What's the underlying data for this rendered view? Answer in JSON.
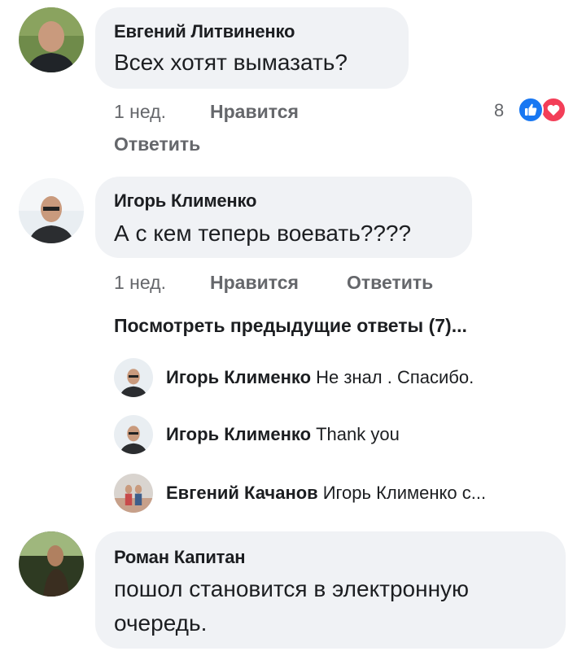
{
  "comments": [
    {
      "author": "Евгений Литвиненко",
      "text": "Всех хотят вымазать?",
      "time": "1 нед.",
      "like_label": "Нравится",
      "reply_label": "Ответить",
      "reactions": {
        "count": "8",
        "icons": [
          "like-icon",
          "love-icon"
        ],
        "colors": {
          "like": "#1877f2",
          "love": "#f33e58"
        }
      }
    },
    {
      "author": "Игорь Клименко",
      "text": "А с кем теперь воевать????",
      "time": "1 нед.",
      "like_label": "Нравится",
      "reply_label": "Ответить"
    },
    {
      "author": "Роман Капитан",
      "text_line1": "пошол становится в электронную",
      "text_line2": "очередь."
    }
  ],
  "view_previous_replies": "Посмотреть предыдущие ответы (7)...",
  "replies": [
    {
      "author": "Игорь Клименко",
      "text": "Не знал . Спасибо."
    },
    {
      "author": "Игорь Клименко",
      "text": "Thank you"
    },
    {
      "author": "Евгений Качанов",
      "text": "Игорь Клименко с..."
    }
  ],
  "colors": {
    "bubble": "#f0f2f5",
    "secondary_text": "#65676b",
    "primary_text": "#1c1e21"
  }
}
